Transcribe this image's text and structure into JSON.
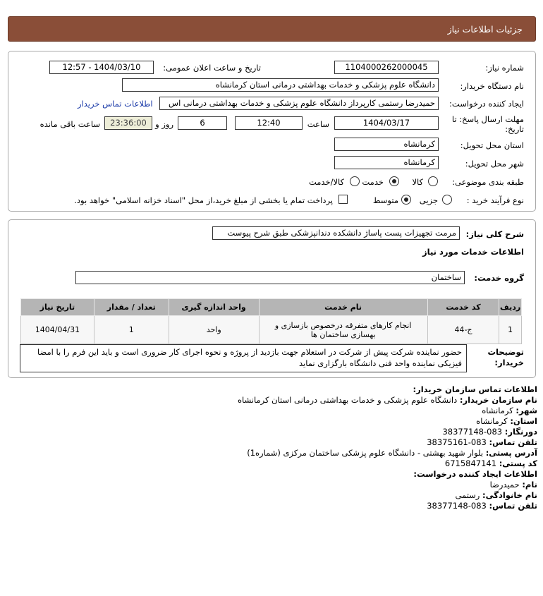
{
  "header": {
    "title": "جزئیات اطلاعات نیاز"
  },
  "form": {
    "need_number": {
      "label": "شماره نیاز:",
      "value": "1104000262000045"
    },
    "announce": {
      "label": "تاریخ و ساعت اعلان عمومی:",
      "value": "1404/03/10 - 12:57"
    },
    "buyer_org": {
      "label": "نام دستگاه خریدار:",
      "value": "دانشگاه علوم پزشکی و خدمات بهداشتی  درمانی استان کرمانشاه"
    },
    "creator": {
      "label": "ایجاد کننده درخواست:",
      "value": "حمیدرضا رستمی کارپرداز دانشگاه علوم پزشکی و خدمات بهداشتی  درمانی اس",
      "contact_link": "اطلاعات تماس خریدار"
    },
    "deadline": {
      "label_line1": "مهلت ارسال پاسخ: تا",
      "label_line2": "تاریخ:",
      "date": "1404/03/17",
      "time_label": "ساعت",
      "time": "12:40",
      "days": "6",
      "days_label": "روز و",
      "remaining": "23:36:00",
      "remaining_label": "ساعت باقی مانده"
    },
    "province": {
      "label": "استان محل تحویل:",
      "value": "کرمانشاه"
    },
    "city": {
      "label": "شهر محل تحویل:",
      "value": "کرمانشاه"
    },
    "category": {
      "label": "طبقه بندی موضوعی:",
      "options": [
        "کالا",
        "خدمت",
        "کالا/خدمت"
      ],
      "selected": "خدمت"
    },
    "process": {
      "label": "نوع فرآیند خرید :",
      "options": [
        "جزیی",
        "متوسط"
      ],
      "selected": "متوسط",
      "checkbox_text": "پرداخت تمام یا بخشی از مبلغ خرید،از محل \"اسناد خزانه اسلامی\" خواهد بود."
    }
  },
  "details": {
    "summary_label": "شرح کلی نیاز:",
    "summary_value": "مرمت تجهیزات پست پاساژ دانشکده دندانپزشکی طبق شرح پیوست",
    "services_title": "اطلاعات خدمات مورد نیاز",
    "group_label": "گروه خدمت:",
    "group_value": "ساختمان",
    "table": {
      "headers": [
        "ردیف",
        "کد خدمت",
        "نام خدمت",
        "واحد اندازه گیری",
        "تعداد / مقدار",
        "تاریخ نیاز"
      ],
      "rows": [
        [
          "1",
          "ج-44",
          "انجام کارهای متفرقه درخصوص بازسازی و بهسازی ساختمان ها",
          "واحد",
          "1",
          "1404/04/31"
        ]
      ]
    },
    "buyer_notes_label_1": "توضیحات",
    "buyer_notes_label_2": "خریدار:",
    "buyer_notes": "حضور نماینده شرکت پیش از شرکت در استعلام جهت بازدید از پروژه و نحوه اجرای کار ضروری است و باید این فرم را با امضا فیزیکی نماینده واحد فنی دانشگاه بارگزاری نماید"
  },
  "contact": {
    "org_title": "اطلاعات تماس سازمان خریدار:",
    "org_name_label": "نام سازمان خریدار:",
    "org_name": "دانشگاه علوم پزشکی و خدمات بهداشتی  درمانی استان کرمانشاه",
    "city_label": "شهر:",
    "city": "کرمانشاه",
    "province_label": "استان:",
    "province": "کرمانشاه",
    "fax_label": "دورنگار:",
    "fax": "083-38377148",
    "phone_label": "تلفن تماس:",
    "phone": "083-38375161",
    "address_label": "آدرس پستی:",
    "address": "بلوار شهید بهشتی - دانشگاه علوم پزشکی ساختمان مرکزی (شماره1)",
    "postal_label": "کد پستی:",
    "postal": "6715847141",
    "creator_title": "اطلاعات ایجاد کننده درخواست:",
    "first_name_label": "نام:",
    "first_name": "حمیدرضا",
    "last_name_label": "نام خانوادگی:",
    "last_name": "رستمی",
    "creator_phone_label": "تلفن تماس:",
    "creator_phone": "083-38377148"
  }
}
